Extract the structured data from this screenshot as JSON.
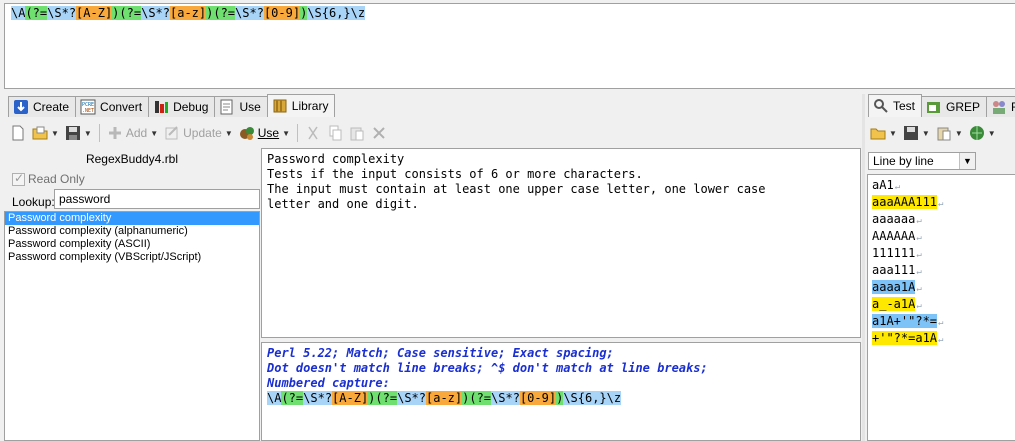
{
  "regex": {
    "tokens": [
      {
        "t": "\\A",
        "c": "base"
      },
      {
        "t": "(?=",
        "c": "green"
      },
      {
        "t": "\\S*?",
        "c": "base"
      },
      {
        "t": "[A-Z]",
        "c": "orange"
      },
      {
        "t": ")",
        "c": "green"
      },
      {
        "t": "(?=",
        "c": "green"
      },
      {
        "t": "\\S*?",
        "c": "base"
      },
      {
        "t": "[a-z]",
        "c": "orange"
      },
      {
        "t": ")",
        "c": "green"
      },
      {
        "t": "(?=",
        "c": "green"
      },
      {
        "t": "\\S*?",
        "c": "base"
      },
      {
        "t": "[0-9]",
        "c": "orange"
      },
      {
        "t": ")",
        "c": "green"
      },
      {
        "t": "\\S{6,}\\z",
        "c": "base"
      }
    ]
  },
  "main_tabs": [
    {
      "label": "Create",
      "icon": "create-icon"
    },
    {
      "label": "Convert",
      "icon": "convert-icon"
    },
    {
      "label": "Debug",
      "icon": "debug-icon"
    },
    {
      "label": "Use",
      "icon": "use-icon"
    },
    {
      "label": "Library",
      "icon": "library-icon",
      "active": true
    }
  ],
  "lib_toolbar": {
    "add": "Add",
    "update": "Update",
    "use": "Use"
  },
  "library": {
    "file": "RegexBuddy4.rbl",
    "read_only": "Read Only",
    "lookup_label": "Lookup:",
    "lookup_value": "password",
    "items": [
      "Password complexity",
      "Password complexity (alphanumeric)",
      "Password complexity (ASCII)",
      "Password complexity (VBScript/JScript)"
    ]
  },
  "description": [
    "Password complexity",
    "Tests if the input consists of 6 or more characters.",
    "The input must contain at least one upper case letter, one lower case",
    "letter and one digit."
  ],
  "detail": [
    "Perl 5.22; Match; Case sensitive; Exact spacing;",
    "Dot doesn't match line breaks; ^$ don't match at line breaks;",
    "Numbered capture:"
  ],
  "test_tabs": [
    {
      "label": "Test",
      "icon": "test-icon",
      "active": true
    },
    {
      "label": "GREP",
      "icon": "grep-icon"
    },
    {
      "label": "F",
      "icon": "forum-icon"
    }
  ],
  "test": {
    "mode": "Line by line",
    "lines": [
      {
        "text": "aA1",
        "hl": "none"
      },
      {
        "text": "aaaAAA111",
        "hl": "yellow"
      },
      {
        "text": "aaaaaa",
        "hl": "none"
      },
      {
        "text": "AAAAAA",
        "hl": "none"
      },
      {
        "text": "111111",
        "hl": "none"
      },
      {
        "text": "aaa111",
        "hl": "none"
      },
      {
        "text": "aaaa1A",
        "hl": "blue"
      },
      {
        "text": "a_-a1A",
        "hl": "yellow"
      },
      {
        "text": "a1A+'\"?*=",
        "hl": "blue"
      },
      {
        "text": "+'\"?*=a1A",
        "hl": "yellow"
      }
    ]
  }
}
